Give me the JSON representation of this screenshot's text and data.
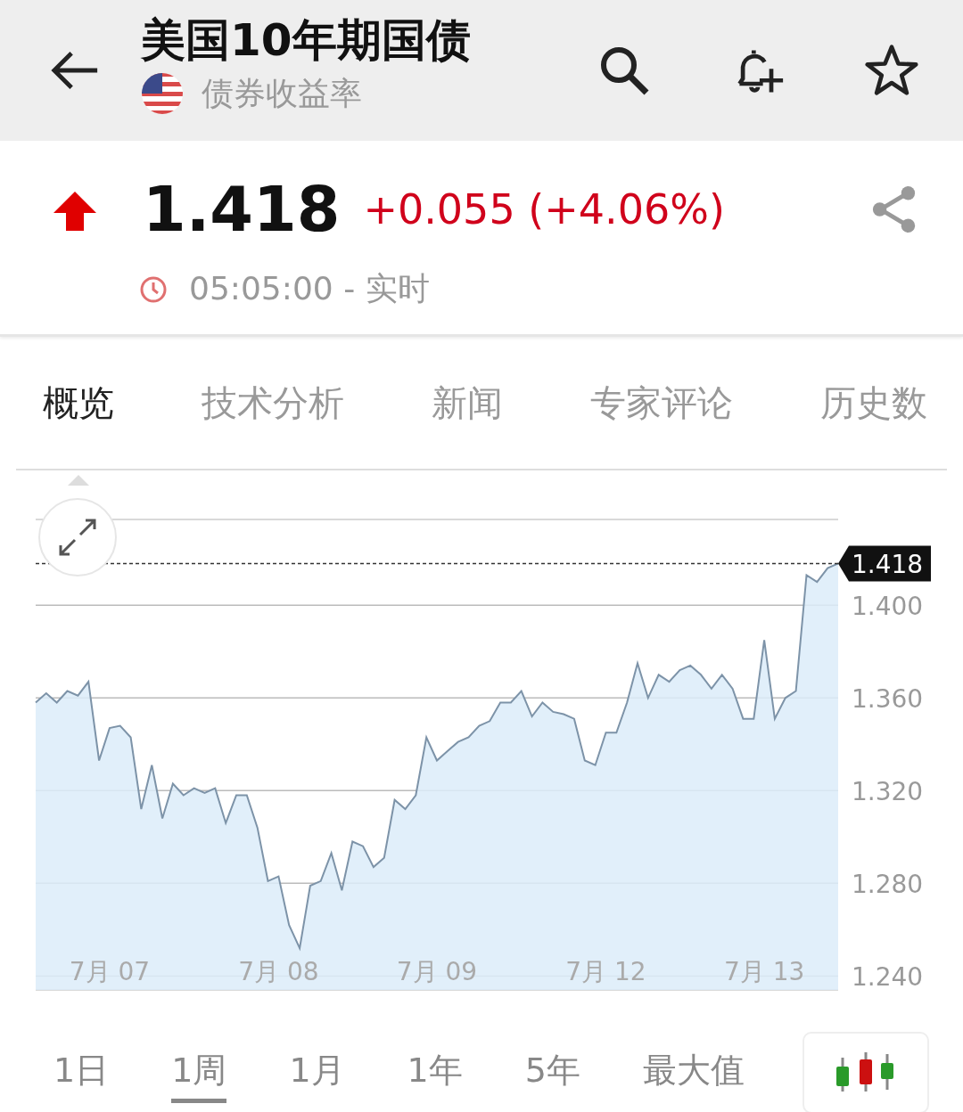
{
  "header": {
    "title": "美国10年期国债",
    "subtitle": "债券收益率"
  },
  "quote": {
    "rising": true,
    "price": "1.418",
    "change": "+0.055 (+4.06%)",
    "time": "05:05:00 - 实时"
  },
  "tabs": [
    {
      "label": "概览",
      "selected": true
    },
    {
      "label": "技术分析",
      "selected": false
    },
    {
      "label": "新闻",
      "selected": false
    },
    {
      "label": "专家评论",
      "selected": false
    },
    {
      "label": "历史数",
      "selected": false
    }
  ],
  "chart_data": {
    "type": "area",
    "grid": true,
    "ylim": [
      1.234,
      1.437
    ],
    "categories": [
      null,
      null,
      null,
      null,
      null,
      null,
      null,
      "7月 07",
      null,
      null,
      null,
      null,
      null,
      null,
      null,
      null,
      null,
      null,
      null,
      null,
      null,
      null,
      null,
      "7月 08",
      null,
      null,
      null,
      null,
      null,
      null,
      null,
      null,
      null,
      null,
      null,
      null,
      null,
      null,
      "7月 09",
      null,
      null,
      null,
      null,
      null,
      null,
      null,
      null,
      null,
      null,
      null,
      null,
      null,
      null,
      null,
      "7月 12",
      null,
      null,
      null,
      null,
      null,
      null,
      null,
      null,
      null,
      null,
      null,
      null,
      null,
      null,
      "7月 13",
      null,
      null,
      null,
      null,
      null,
      null,
      null
    ],
    "yticks": [
      {
        "value": 1.24,
        "label": "1.240"
      },
      {
        "value": 1.28,
        "label": "1.280"
      },
      {
        "value": 1.32,
        "label": "1.320"
      },
      {
        "value": 1.36,
        "label": "1.360"
      },
      {
        "value": 1.4,
        "label": "1.400"
      }
    ],
    "series": [
      {
        "color": "#7d93a8",
        "values": [
          1.358,
          1.362,
          1.358,
          1.363,
          1.361,
          1.367,
          1.333,
          1.347,
          1.348,
          1.343,
          1.312,
          1.331,
          1.308,
          1.323,
          1.318,
          1.321,
          1.319,
          1.321,
          1.306,
          1.318,
          1.318,
          1.304,
          1.281,
          1.283,
          1.262,
          1.252,
          1.279,
          1.281,
          1.293,
          1.277,
          1.298,
          1.296,
          1.287,
          1.291,
          1.316,
          1.312,
          1.318,
          1.343,
          1.333,
          1.337,
          1.341,
          1.343,
          1.348,
          1.35,
          1.358,
          1.358,
          1.363,
          1.352,
          1.358,
          1.354,
          1.353,
          1.351,
          1.333,
          1.331,
          1.345,
          1.345,
          1.358,
          1.375,
          1.36,
          1.37,
          1.367,
          1.372,
          1.374,
          1.37,
          1.364,
          1.37,
          1.364,
          1.351,
          1.351,
          1.385,
          1.351,
          1.36,
          1.363,
          1.413,
          1.41,
          1.416,
          1.418
        ]
      }
    ],
    "ref_lines": [
      {
        "axis": "y",
        "value": 1.418,
        "label": "1.418"
      }
    ]
  },
  "ranges": [
    {
      "label": "1日",
      "selected": false
    },
    {
      "label": "1周",
      "selected": true
    },
    {
      "label": "1月",
      "selected": false
    },
    {
      "label": "1年",
      "selected": false
    },
    {
      "label": "5年",
      "selected": false
    },
    {
      "label": "最大值",
      "selected": false
    }
  ]
}
